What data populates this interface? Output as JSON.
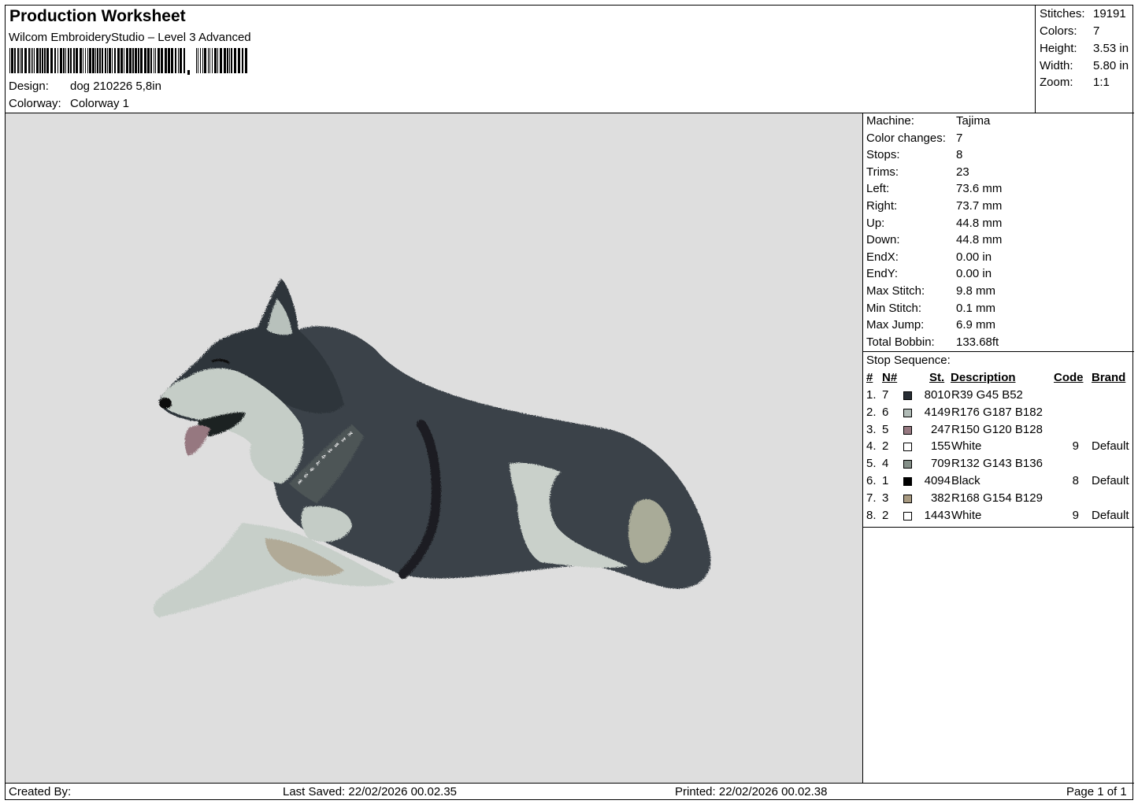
{
  "header": {
    "title": "Production Worksheet",
    "software": "Wilcom EmbroideryStudio – Level 3 Advanced",
    "design_label": "Design:",
    "design_value": "dog 210226 5,8in",
    "colorway_label": "Colorway:",
    "colorway_value": "Colorway 1"
  },
  "summary": {
    "stitches_label": "Stitches:",
    "stitches_value": "19191",
    "colors_label": "Colors:",
    "colors_value": "7",
    "height_label": "Height:",
    "height_value": "3.53 in",
    "width_label": "Width:",
    "width_value": "5.80 in",
    "zoom_label": "Zoom:",
    "zoom_value": "1:1"
  },
  "machine_info": [
    {
      "label": "Machine:",
      "value": "Tajima"
    },
    {
      "label": "Color changes:",
      "value": "7"
    },
    {
      "label": "Stops:",
      "value": "8"
    },
    {
      "label": "Trims:",
      "value": "23"
    },
    {
      "label": "Left:",
      "value": "73.6 mm"
    },
    {
      "label": "Right:",
      "value": "73.7 mm"
    },
    {
      "label": "Up:",
      "value": "44.8 mm"
    },
    {
      "label": "Down:",
      "value": "44.8 mm"
    },
    {
      "label": "EndX:",
      "value": "0.00 in"
    },
    {
      "label": "EndY:",
      "value": "0.00 in"
    },
    {
      "label": "Max Stitch:",
      "value": "9.8 mm"
    },
    {
      "label": "Min Stitch:",
      "value": "0.1 mm"
    },
    {
      "label": "Max Jump:",
      "value": "6.9 mm"
    },
    {
      "label": "Total Bobbin:",
      "value": "133.68ft"
    }
  ],
  "stop_sequence": {
    "title": "Stop Sequence:",
    "columns": {
      "num": "#",
      "n": "N#",
      "st": "St.",
      "description": "Description",
      "code": "Code",
      "brand": "Brand"
    },
    "rows": [
      {
        "num": "1.",
        "n": "7",
        "st": "8010",
        "description": "R39 G45 B52",
        "code": "",
        "brand": "",
        "color": "#272d34"
      },
      {
        "num": "2.",
        "n": "6",
        "st": "4149",
        "description": "R176 G187 B182",
        "code": "",
        "brand": "",
        "color": "#b0bbb6"
      },
      {
        "num": "3.",
        "n": "5",
        "st": "247",
        "description": "R150 G120 B128",
        "code": "",
        "brand": "",
        "color": "#967880"
      },
      {
        "num": "4.",
        "n": "2",
        "st": "155",
        "description": "White",
        "code": "9",
        "brand": "Default",
        "color": "#ffffff"
      },
      {
        "num": "5.",
        "n": "4",
        "st": "709",
        "description": "R132 G143 B136",
        "code": "",
        "brand": "",
        "color": "#848f88"
      },
      {
        "num": "6.",
        "n": "1",
        "st": "4094",
        "description": "Black",
        "code": "8",
        "brand": "Default",
        "color": "#000000"
      },
      {
        "num": "7.",
        "n": "3",
        "st": "382",
        "description": "R168 G154 B129",
        "code": "",
        "brand": "",
        "color": "#a89a81"
      },
      {
        "num": "8.",
        "n": "2",
        "st": "1443",
        "description": "White",
        "code": "9",
        "brand": "Default",
        "color": "#ffffff"
      }
    ]
  },
  "footer": {
    "created_by": "Created By:",
    "last_saved": "Last Saved: 22/02/2026 00.02.35",
    "printed": "Printed: 22/02/2026 00.02.38",
    "page": "Page 1 of 1"
  },
  "design_preview": {
    "subject": "embroidered husky dog lying down",
    "background_color": "#dedede"
  }
}
